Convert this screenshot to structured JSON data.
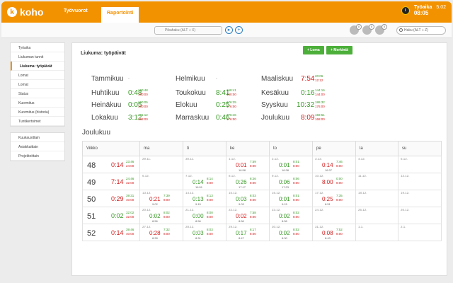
{
  "app": {
    "logo": "koho",
    "nav": [
      "Työvuorot",
      "Raportointi"
    ],
    "active_nav": "Raportointi",
    "user_name": "Työaika",
    "user_date": "5.02",
    "clock_time": "08:05"
  },
  "toolbar": {
    "quick_search_placeholder": "Pikahaku (ALT + X)",
    "search_placeholder": "Haku (ALT + Z)",
    "play_icon": "play-icon",
    "add_icon": "plus-icon",
    "icon_badges": [
      "0",
      "0",
      "0"
    ]
  },
  "sidebar": {
    "group1": [
      "Työaika",
      "Liukuman tunnit",
      "Liukuma: työpäivät",
      "Lomat",
      "Lomat",
      "Status",
      "Kuormitus",
      "Kuormitus (historia)",
      "Tuntikertoimet"
    ],
    "active_item": "Liukuma: työpäivät",
    "group2": [
      "Kuukausittain",
      "Asiakkaittain",
      "Projekteittain"
    ]
  },
  "main": {
    "title": "Liukuma: työpäivät",
    "btn_loma": "+ Loma",
    "btn_merkinta": "+ Merkintä"
  },
  "months": [
    {
      "name": "Tammikuu",
      "balance": "",
      "done": "",
      "target": "",
      "dash": "-"
    },
    {
      "name": "Helmikuu",
      "balance": "",
      "done": "",
      "target": "",
      "dash": "-"
    },
    {
      "name": "Maaliskuu",
      "balance": "7:54",
      "done": "20:06",
      "target": "12:12",
      "sign": "neg"
    },
    {
      "name": "Huhtikuu",
      "balance": "0:48",
      "done": "160:48",
      "target": "160:00",
      "sign": "pos"
    },
    {
      "name": "Toukokuu",
      "balance": "8:41",
      "done": "168:41",
      "target": "160:00",
      "sign": "pos"
    },
    {
      "name": "Kesäkuu",
      "balance": "0:16",
      "done": "144:16",
      "target": "144:00",
      "sign": "pos"
    },
    {
      "name": "Heinäkuu",
      "balance": "0:05",
      "done": "160:05",
      "target": "160:00",
      "sign": "pos"
    },
    {
      "name": "Elokuu",
      "balance": "0:25",
      "done": "176:25",
      "target": "176:00",
      "sign": "pos"
    },
    {
      "name": "Syyskuu",
      "balance": "10:32",
      "done": "186:32",
      "target": "176:00",
      "sign": "pos"
    },
    {
      "name": "Lokakuu",
      "balance": "3:12",
      "done": "171:12",
      "target": "168:00",
      "sign": "pos"
    },
    {
      "name": "Marraskuu",
      "balance": "0:46",
      "done": "176:46",
      "target": "176:00",
      "sign": "pos"
    },
    {
      "name": "Joulukuu",
      "balance": "8:09",
      "done": "159:51",
      "target": "168:00",
      "sign": "neg"
    }
  ],
  "december": {
    "title": "Joulukuu",
    "headers": [
      "Viikko",
      "ma",
      "ti",
      "ke",
      "to",
      "pe",
      "la",
      "su"
    ],
    "weeks": [
      {
        "week": "48",
        "balance": "0:14",
        "sign": "neg",
        "done": "23:46",
        "target": "24:00",
        "days": [
          {
            "date": "29.11.",
            "grey": true
          },
          {
            "date": "30.11.",
            "grey": true
          },
          {
            "date": "1.12.",
            "balance": "0:01",
            "sign": "neg",
            "done": "7:59",
            "target": "8:00",
            "time": "16:58"
          },
          {
            "date": "2.12.",
            "balance": "0:01",
            "sign": "pos",
            "done": "8:01",
            "target": "8:00",
            "time": "16:38"
          },
          {
            "date": "3.12.",
            "balance": "0:14",
            "sign": "neg",
            "done": "7:46",
            "target": "8:00",
            "time": "16:37"
          },
          {
            "date": "4.12.",
            "grey": true
          },
          {
            "date": "5.12.",
            "grey": true
          }
        ]
      },
      {
        "week": "49",
        "balance": "7:14",
        "sign": "neg",
        "done": "24:46",
        "target": "32:00",
        "days": [
          {
            "date": "6.12.",
            "grey": true
          },
          {
            "date": "7.12.",
            "balance": "0:14",
            "sign": "pos",
            "done": "8:14",
            "target": "8:00",
            "time": "16:51"
          },
          {
            "date": "8.12.",
            "balance": "0:26",
            "sign": "pos",
            "done": "8:26",
            "target": "8:00",
            "time": "17:17"
          },
          {
            "date": "9.12.",
            "balance": "0:06",
            "sign": "pos",
            "done": "8:06",
            "target": "8:00",
            "time": "17:23"
          },
          {
            "date": "10.12.",
            "balance": "8:00",
            "sign": "neg",
            "done": "0:00",
            "target": "8:00",
            "time": ""
          },
          {
            "date": "11.12.",
            "grey": true
          },
          {
            "date": "12.12.",
            "grey": true
          }
        ]
      },
      {
        "week": "50",
        "balance": "0:29",
        "sign": "neg",
        "done": "39:31",
        "target": "40:00",
        "days": [
          {
            "date": "13.12.",
            "balance": "0:21",
            "sign": "neg",
            "done": "7:39",
            "target": "8:00",
            "time": "9:02"
          },
          {
            "date": "14.12.",
            "balance": "0:13",
            "sign": "pos",
            "done": "8:13",
            "target": "8:00",
            "time": "9:15"
          },
          {
            "date": "15.12.",
            "balance": "0:03",
            "sign": "pos",
            "done": "8:03",
            "target": "8:00",
            "time": "9:03"
          },
          {
            "date": "16.12.",
            "balance": "0:01",
            "sign": "pos",
            "done": "8:01",
            "target": "8:00",
            "time": "9:15"
          },
          {
            "date": "17.12.",
            "balance": "0:25",
            "sign": "neg",
            "done": "7:35",
            "target": "8:00",
            "time": "8:51"
          },
          {
            "date": "18.12.",
            "grey": true
          },
          {
            "date": "19.12.",
            "grey": true
          }
        ]
      },
      {
        "week": "51",
        "balance": "0:02",
        "sign": "pos",
        "done": "32:02",
        "target": "32:00",
        "days": [
          {
            "date": "20.12.",
            "balance": "0:02",
            "sign": "pos",
            "done": "8:02",
            "target": "8:00",
            "time": "8:56"
          },
          {
            "date": "21.12.",
            "balance": "0:00",
            "sign": "pos",
            "done": "8:00",
            "target": "8:00",
            "time": "8:56"
          },
          {
            "date": "22.12.",
            "balance": "0:02",
            "sign": "neg",
            "done": "7:58",
            "target": "8:00",
            "time": "8:56"
          },
          {
            "date": "23.12.",
            "balance": "0:02",
            "sign": "pos",
            "done": "8:02",
            "target": "8:00",
            "time": "8:56"
          },
          {
            "date": "24.12.",
            "grey": true
          },
          {
            "date": "25.12.",
            "grey": true
          },
          {
            "date": "26.12.",
            "grey": true
          }
        ]
      },
      {
        "week": "52",
        "balance": "0:14",
        "sign": "neg",
        "done": "39:46",
        "target": "40:00",
        "days": [
          {
            "date": "27.12.",
            "balance": "0:28",
            "sign": "neg",
            "done": "7:32",
            "target": "8:00",
            "time": "8:28"
          },
          {
            "date": "28.12.",
            "balance": "0:03",
            "sign": "pos",
            "done": "8:03",
            "target": "8:00",
            "time": "8:31"
          },
          {
            "date": "29.12.",
            "balance": "0:17",
            "sign": "pos",
            "done": "8:17",
            "target": "8:00",
            "time": "8:47"
          },
          {
            "date": "30.12.",
            "balance": "0:02",
            "sign": "pos",
            "done": "8:02",
            "target": "8:00",
            "time": "8:30"
          },
          {
            "date": "31.12.",
            "balance": "0:08",
            "sign": "neg",
            "done": "7:52",
            "target": "8:00",
            "time": "8:43"
          },
          {
            "date": "1.1.",
            "grey": true
          },
          {
            "date": "2.1.",
            "grey": true
          }
        ]
      }
    ]
  },
  "colors": {
    "brand": "#f39200",
    "positive": "#3a9a28",
    "negative": "#d42020",
    "button": "#4caf3a"
  }
}
